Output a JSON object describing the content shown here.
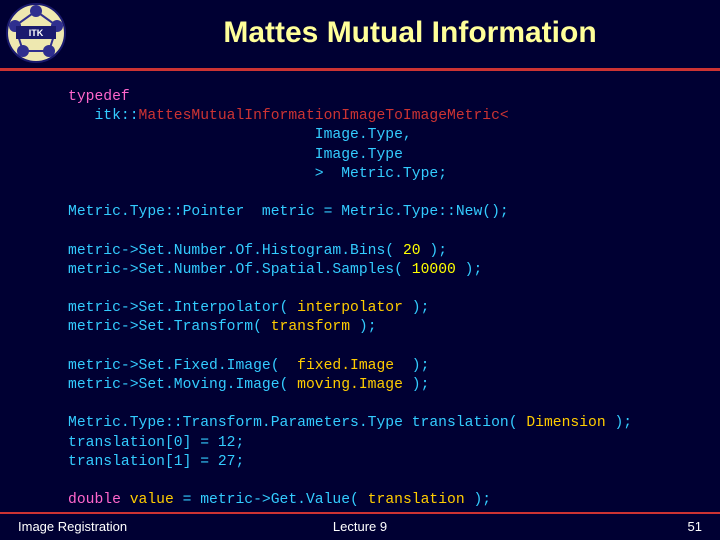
{
  "slide": {
    "title": "Mattes Mutual Information",
    "background_color": "#000033",
    "rule_color": "#CC3333",
    "title_color": "#FFFF99"
  },
  "logo": {
    "name": "nlm-insight-toolkit-logo",
    "text": "ITK"
  },
  "code": {
    "font_color": "#33CCFF",
    "keyword_color": "#FF66CC",
    "type_color": "#CC3333",
    "number_color": "#FFFF00",
    "identifier_color": "#FFCC00",
    "lines": [
      "typedef",
      "   itk::MattesMutualInformationImageToImageMetric<",
      "                            Image.Type,",
      "                            Image.Type",
      "                            >  Metric.Type;",
      "",
      "Metric.Type::Pointer  metric = Metric.Type::New();",
      "",
      "metric->Set.Number.Of.Histogram.Bins( 20 );",
      "metric->Set.Number.Of.Spatial.Samples( 10000 );",
      "",
      "metric->Set.Interpolator( interpolator );",
      "metric->Set.Transform( transform );",
      "",
      "metric->Set.Fixed.Image(  fixed.Image  );",
      "metric->Set.Moving.Image( moving.Image );",
      "",
      "Metric.Type::Transform.Parameters.Type translation( Dimension );",
      "translation[0] = 12;",
      "translation[1] = 27;",
      "",
      "double value = metric->Get.Value( translation );"
    ],
    "tokens": {
      "typedef": "typedef",
      "itk_prefix": "   itk::",
      "metric_class": "MattesMutualInformationImageToImageMetric",
      "open_angle": "<",
      "image_type_1": "Image.Type,",
      "image_type_2": "Image.Type",
      "close_angle": ">  Metric.Type;",
      "metric_type_pointer": "Metric.Type::Pointer  metric = Metric.Type::New();",
      "set_bins_prefix": "metric->Set.Number.Of.Histogram.Bins( ",
      "set_bins_value": "20",
      "set_bins_suffix": " );",
      "set_samples_prefix": "metric->Set.Number.Of.Spatial.Samples( ",
      "set_samples_value": "10000",
      "set_samples_suffix": " );",
      "set_interpolator_prefix": "metric->Set.Interpolator( ",
      "set_interpolator_arg": "interpolator",
      "set_interpolator_suffix": " );",
      "set_transform_prefix": "metric->Set.Transform( ",
      "set_transform_arg": "transform",
      "set_transform_suffix": " );",
      "set_fixed_prefix": "metric->Set.Fixed.Image(  ",
      "set_fixed_arg": "fixed.Image",
      "set_fixed_suffix": "  );",
      "set_moving_prefix": "metric->Set.Moving.Image( ",
      "set_moving_arg": "moving.Image",
      "set_moving_suffix": " );",
      "params_type": "Metric.Type::Transform.Parameters.Type translation( ",
      "params_dimension": "Dimension",
      "params_suffix": " );",
      "translation_0": "translation[0] = 12;",
      "translation_1": "translation[1] = 27;",
      "double_kw": "double",
      "value_name": " value ",
      "get_value_prefix": "= metric->Get.Value( ",
      "get_value_arg": "translation",
      "get_value_suffix": " );"
    }
  },
  "footer": {
    "left": "Image Registration",
    "center": "Lecture 9",
    "page_number": "51"
  }
}
